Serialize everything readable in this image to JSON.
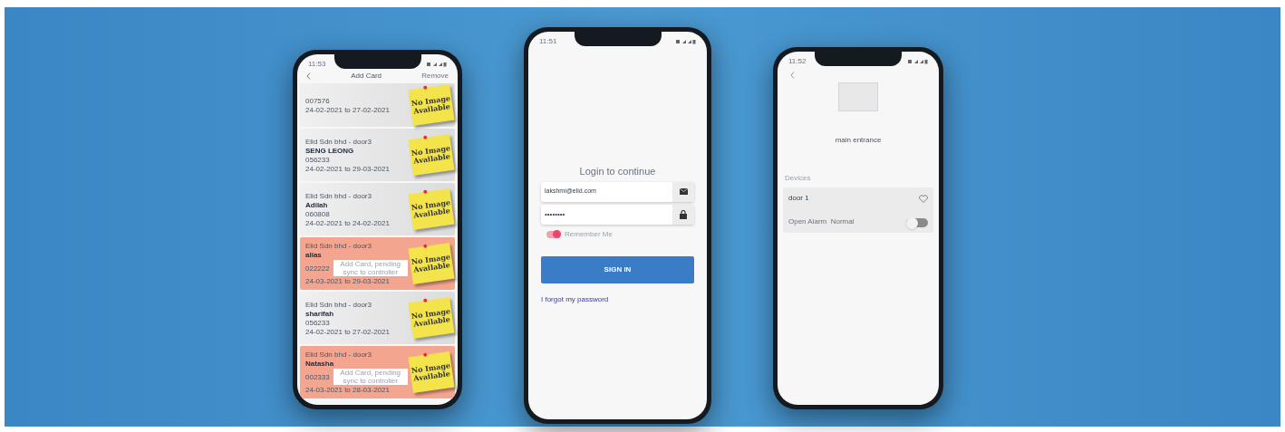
{
  "card_list_phone": {
    "status_time": "11:53",
    "title": "Add Card",
    "action": "Remove",
    "cards": [
      {
        "pending": false,
        "partial": true,
        "card_no": "007576",
        "dates": "24-02-2021 to 27-02-2021",
        "note": "No Image Available"
      },
      {
        "pending": false,
        "partial": false,
        "site": "Elid Sdn bhd - door3",
        "name": "SENG LEONG",
        "card_no": "056233",
        "dates": "24-02-2021 to 29-03-2021",
        "note": "No Image Available"
      },
      {
        "pending": false,
        "partial": false,
        "site": "Elid Sdn bhd - door3",
        "name": "Adilah",
        "card_no": "060808",
        "dates": "24-02-2021 to 24-02-2021",
        "note": "No Image Available"
      },
      {
        "pending": true,
        "partial": false,
        "site": "Elid Sdn bhd - door3",
        "name": "alias",
        "card_no": "022222",
        "dates": "24-03-2021 to 29-03-2021",
        "pending_text": "Add Card, pending sync to controller",
        "note": "No Image Available"
      },
      {
        "pending": false,
        "partial": false,
        "site": "Elid Sdn bhd - door3",
        "name": "sharifah",
        "card_no": "056233",
        "dates": "24-02-2021 to 27-02-2021",
        "note": "No Image Available"
      },
      {
        "pending": true,
        "partial": false,
        "site": "Elid Sdn bhd - door3",
        "name": "Natasha",
        "card_no": "002333",
        "dates": "24-03-2021 to 28-03-2021",
        "pending_text": "Add Card, pending sync to controller",
        "note": "No Image Available"
      }
    ]
  },
  "login_phone": {
    "status_time": "11:51",
    "heading": "Login to continue",
    "email": {
      "value": "lakshmi@elid.com"
    },
    "password": {
      "value": "••••••••"
    },
    "remember": {
      "label": "Remember Me",
      "on": true
    },
    "sign_in": "SIGN IN",
    "forgot": "I forgot my password"
  },
  "door_phone": {
    "status_time": "11:52",
    "location": "main entrance",
    "section": "Devices",
    "devices": [
      {
        "name": "door 1",
        "status": "Open Alarm  Normal",
        "favorite": false,
        "on": false
      }
    ]
  }
}
